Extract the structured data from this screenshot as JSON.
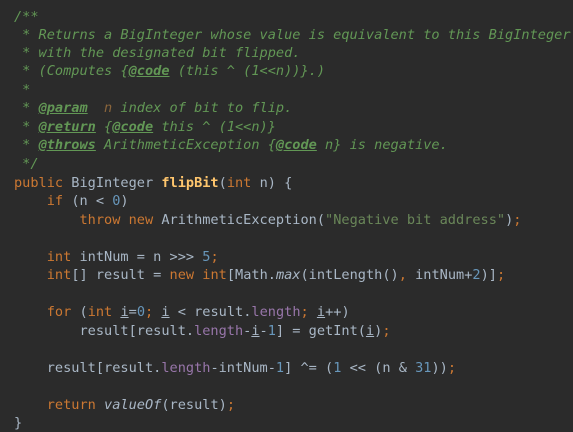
{
  "editor": {
    "theme": "darcula",
    "colors": {
      "background": "#2b2b2b",
      "default_text": "#a9b7c6",
      "keyword": "#cc7832",
      "number": "#6897bb",
      "string": "#6a8759",
      "doc_comment": "#629755",
      "method_declaration": "#ffc66d",
      "field": "#9876aa"
    },
    "lines": [
      [
        {
          "t": "/**",
          "c": "doc"
        }
      ],
      [
        {
          "t": " * Returns a BigInteger whose value is equivalent to this BigInteger",
          "c": "doc"
        }
      ],
      [
        {
          "t": " * with the designated bit flipped.",
          "c": "doc"
        }
      ],
      [
        {
          "t": " * (Computes ",
          "c": "doc"
        },
        {
          "t": "{",
          "c": "doc"
        },
        {
          "t": "@code",
          "c": "doctag"
        },
        {
          "t": " (this ^ (1<<n))}",
          "c": "doc"
        },
        {
          "t": ".)",
          "c": "doc"
        }
      ],
      [
        {
          "t": " *",
          "c": "doc"
        }
      ],
      [
        {
          "t": " * ",
          "c": "doc"
        },
        {
          "t": "@param",
          "c": "doctag"
        },
        {
          "t": "  n",
          "c": "docval"
        },
        {
          "t": " index of bit to flip.",
          "c": "doc"
        }
      ],
      [
        {
          "t": " * ",
          "c": "doc"
        },
        {
          "t": "@return",
          "c": "doctag"
        },
        {
          "t": " {",
          "c": "doc"
        },
        {
          "t": "@code",
          "c": "doctag"
        },
        {
          "t": " this ^ (1<<n)}",
          "c": "doc"
        }
      ],
      [
        {
          "t": " * ",
          "c": "doc"
        },
        {
          "t": "@throws",
          "c": "doctag"
        },
        {
          "t": " ArithmeticException",
          "c": "doc"
        },
        {
          "t": " {",
          "c": "doc"
        },
        {
          "t": "@code",
          "c": "doctag"
        },
        {
          "t": " n}",
          "c": "doc"
        },
        {
          "t": " is negative.",
          "c": "doc"
        }
      ],
      [
        {
          "t": " */",
          "c": "doc"
        }
      ],
      [
        {
          "t": "public ",
          "c": "kw"
        },
        {
          "t": "BigInteger ",
          "c": "plain"
        },
        {
          "t": "flipBit",
          "c": "fn"
        },
        {
          "t": "(",
          "c": "plain"
        },
        {
          "t": "int ",
          "c": "kw"
        },
        {
          "t": "n) {",
          "c": "plain"
        }
      ],
      [
        {
          "t": "    ",
          "c": "plain"
        },
        {
          "t": "if ",
          "c": "kw"
        },
        {
          "t": "(n < ",
          "c": "plain"
        },
        {
          "t": "0",
          "c": "num"
        },
        {
          "t": ")",
          "c": "plain"
        }
      ],
      [
        {
          "t": "        ",
          "c": "plain"
        },
        {
          "t": "throw new ",
          "c": "kw"
        },
        {
          "t": "ArithmeticException(",
          "c": "plain"
        },
        {
          "t": "\"Negative bit address\"",
          "c": "str"
        },
        {
          "t": ")",
          "c": "plain"
        },
        {
          "t": ";",
          "c": "kw"
        }
      ],
      [],
      [
        {
          "t": "    ",
          "c": "plain"
        },
        {
          "t": "int ",
          "c": "kw"
        },
        {
          "t": "intNum = n >>> ",
          "c": "plain"
        },
        {
          "t": "5",
          "c": "num"
        },
        {
          "t": ";",
          "c": "kw"
        }
      ],
      [
        {
          "t": "    ",
          "c": "plain"
        },
        {
          "t": "int",
          "c": "kw"
        },
        {
          "t": "[] result = ",
          "c": "plain"
        },
        {
          "t": "new int",
          "c": "kw"
        },
        {
          "t": "[Math.",
          "c": "plain"
        },
        {
          "t": "max",
          "c": "static"
        },
        {
          "t": "(intLength()",
          "c": "plain"
        },
        {
          "t": ", ",
          "c": "kw"
        },
        {
          "t": "intNum+",
          "c": "plain"
        },
        {
          "t": "2",
          "c": "num"
        },
        {
          "t": ")]",
          "c": "plain"
        },
        {
          "t": ";",
          "c": "kw"
        }
      ],
      [],
      [
        {
          "t": "    ",
          "c": "plain"
        },
        {
          "t": "for ",
          "c": "kw"
        },
        {
          "t": "(",
          "c": "plain"
        },
        {
          "t": "int ",
          "c": "kw"
        },
        {
          "t": "i",
          "c": "ul"
        },
        {
          "t": "=",
          "c": "plain"
        },
        {
          "t": "0",
          "c": "num"
        },
        {
          "t": "; ",
          "c": "kw"
        },
        {
          "t": "i",
          "c": "ul"
        },
        {
          "t": " < result.",
          "c": "plain"
        },
        {
          "t": "length",
          "c": "field"
        },
        {
          "t": "; ",
          "c": "kw"
        },
        {
          "t": "i",
          "c": "ul"
        },
        {
          "t": "++)",
          "c": "plain"
        }
      ],
      [
        {
          "t": "        ",
          "c": "plain"
        },
        {
          "t": "result[result.",
          "c": "plain"
        },
        {
          "t": "length",
          "c": "field"
        },
        {
          "t": "-",
          "c": "plain"
        },
        {
          "t": "i",
          "c": "ul"
        },
        {
          "t": "-",
          "c": "plain"
        },
        {
          "t": "1",
          "c": "num"
        },
        {
          "t": "] = getInt(",
          "c": "plain"
        },
        {
          "t": "i",
          "c": "ul"
        },
        {
          "t": ")",
          "c": "plain"
        },
        {
          "t": ";",
          "c": "kw"
        }
      ],
      [],
      [
        {
          "t": "    ",
          "c": "plain"
        },
        {
          "t": "result[result.",
          "c": "plain"
        },
        {
          "t": "length",
          "c": "field"
        },
        {
          "t": "-intNum-",
          "c": "plain"
        },
        {
          "t": "1",
          "c": "num"
        },
        {
          "t": "] ^= (",
          "c": "plain"
        },
        {
          "t": "1 ",
          "c": "num"
        },
        {
          "t": "<< (n & ",
          "c": "plain"
        },
        {
          "t": "31",
          "c": "num"
        },
        {
          "t": "))",
          "c": "plain"
        },
        {
          "t": ";",
          "c": "kw"
        }
      ],
      [],
      [
        {
          "t": "    ",
          "c": "plain"
        },
        {
          "t": "return ",
          "c": "kw"
        },
        {
          "t": "valueOf",
          "c": "static"
        },
        {
          "t": "(result)",
          "c": "plain"
        },
        {
          "t": ";",
          "c": "kw"
        }
      ],
      [
        {
          "t": "}",
          "c": "plain"
        }
      ]
    ]
  }
}
